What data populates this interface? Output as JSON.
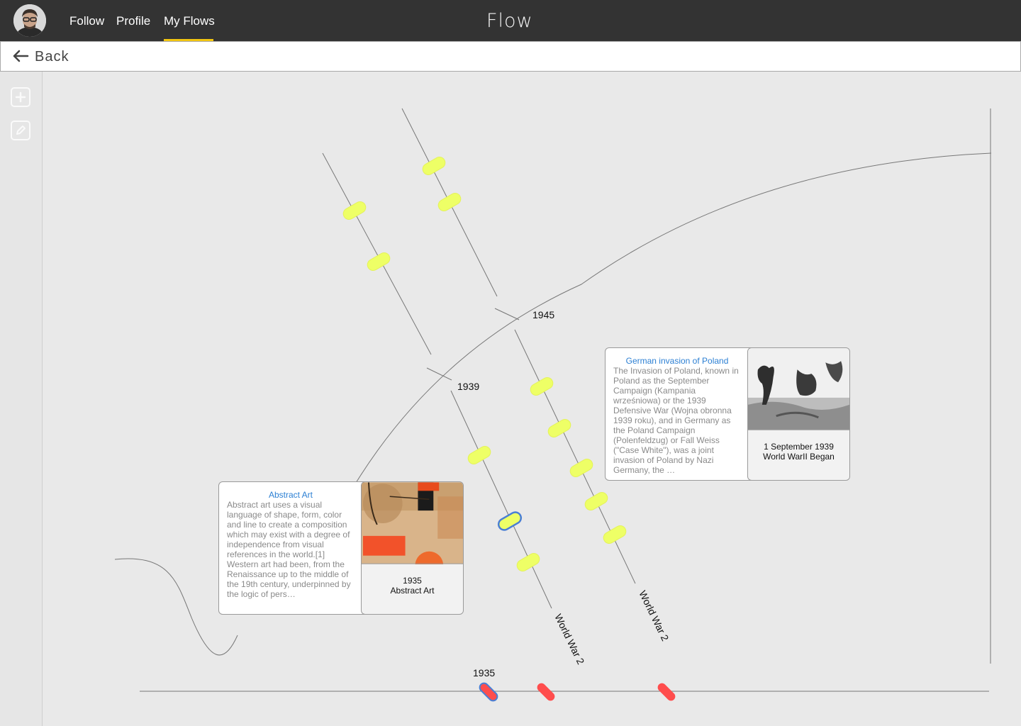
{
  "app": {
    "brand": "Flow"
  },
  "nav": {
    "items": [
      {
        "label": "Follow"
      },
      {
        "label": "Profile"
      },
      {
        "label": "My Flows"
      }
    ],
    "active": "My Flows"
  },
  "back": {
    "label": "Back"
  },
  "tools": [
    {
      "icon": "plus-square-icon"
    },
    {
      "icon": "pencil-square-icon"
    }
  ],
  "colors": {
    "topbar": "#333333",
    "accent": "#f2c511",
    "event": "#eeff66",
    "selected_outline": "#4a7fd4",
    "marker": "#ff4d4d",
    "link": "#2b7fd3"
  },
  "flows": {
    "year_labels": [
      "1945",
      "1939",
      "1935"
    ],
    "flow_labels": [
      "World War 2",
      "World War 2"
    ]
  },
  "cards": {
    "abstract_art": {
      "title": "Abstract Art",
      "description": "Abstract art uses a visual language of shape, form, color and line to create a composition which may exist with a degree of independence from visual references in the world.[1] Western art had been, from the Renaissance up to the middle of the 19th century, underpinned by the logic of pers…",
      "caption_date": "1935",
      "caption_title": "Abstract Art"
    },
    "poland": {
      "title": "German invasion of Poland",
      "description": "The Invasion of Poland, known in Poland as the September Campaign (Kampania wrześniowa) or the 1939 Defensive War (Wojna obronna 1939 roku), and in Germany as the Poland Campaign (Polenfeldzug) or Fall Weiss (\"Case White\"), was a joint invasion of Poland by Nazi Germany, the …",
      "caption_date": "1 September 1939",
      "caption_title": "World WarII Began"
    }
  }
}
